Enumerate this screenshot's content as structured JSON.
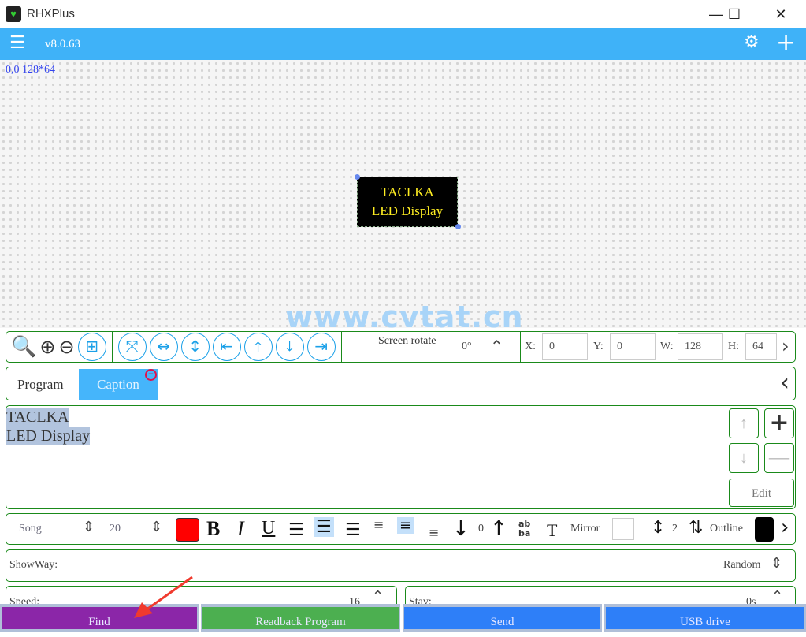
{
  "window": {
    "title": "RHXPlus",
    "minimize": "—",
    "maximize": "☐",
    "close": "✕"
  },
  "topbar": {
    "version": "v8.0.63"
  },
  "canvas": {
    "coords": "0,0 128*64",
    "preview_line1": "TACLKA",
    "preview_line2": "LED Display",
    "watermark": "www.cvtat.cn"
  },
  "toolbar": {
    "screen_rotate_label": "Screen rotate",
    "rotate_value": "0°",
    "x_label": "X:",
    "x": "0",
    "y_label": "Y:",
    "y": "0",
    "w_label": "W:",
    "w": "128",
    "h_label": "H:",
    "h": "64"
  },
  "tabs": [
    {
      "label": "Program"
    },
    {
      "label": "Caption"
    }
  ],
  "editor": {
    "line1": "TACLKA",
    "line2": "LED Display",
    "edit_label": "Edit"
  },
  "format": {
    "font": "Song",
    "size": "20",
    "color": "#ff0000",
    "bold": "B",
    "italic": "I",
    "underline": "U",
    "offset": "0",
    "mirror_label": "Mirror",
    "spacing": "2",
    "outline_label": "Outline",
    "outline_color": "#000000"
  },
  "showway": {
    "label": "ShowWay:",
    "value": "Random"
  },
  "speed": {
    "label": "Speed:",
    "value": "16"
  },
  "stay": {
    "label": "Stay:",
    "value": "0s"
  },
  "buttons": {
    "find": "Find",
    "readback": "Readback Program",
    "send": "Send",
    "usb": "USB drive"
  }
}
